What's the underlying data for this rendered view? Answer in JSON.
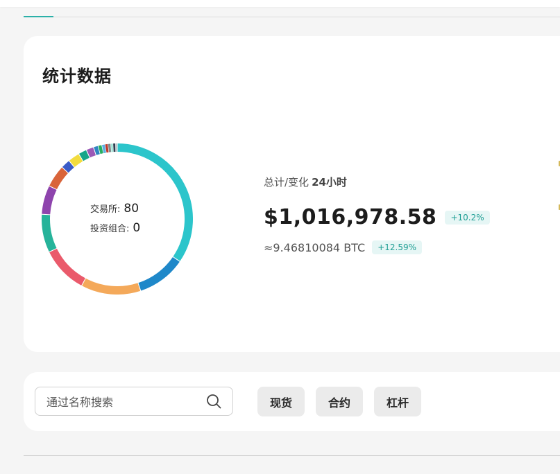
{
  "stats": {
    "title": "统计数据",
    "exchanges_label": "交易所:",
    "exchanges_count": "80",
    "portfolios_label": "投资组合:",
    "portfolios_count": "0",
    "summary_label": "总计/变化",
    "summary_period": "24小时",
    "total_value": "$1,016,978.58",
    "total_change": "+10.2%",
    "btc_value": "≈9.46810084 BTC",
    "btc_change": "+12.59%"
  },
  "donut": {
    "segments": [
      {
        "color": "#2cc5cb",
        "share": 0.345
      },
      {
        "color": "#1f88c9",
        "share": 0.105
      },
      {
        "color": "#f4a95a",
        "share": 0.128
      },
      {
        "color": "#ea5a6b",
        "share": 0.1
      },
      {
        "color": "#26b39a",
        "share": 0.082
      },
      {
        "color": "#8e44ad",
        "share": 0.062
      },
      {
        "color": "#d9643a",
        "share": 0.048
      },
      {
        "color": "#3a5bc7",
        "share": 0.02
      },
      {
        "color": "#f2dc3f",
        "share": 0.025
      },
      {
        "color": "#17a589",
        "share": 0.018
      },
      {
        "color": "#9b59b6",
        "share": 0.016
      },
      {
        "color": "#2e86c1",
        "share": 0.01
      },
      {
        "color": "#27ae60",
        "share": 0.008
      },
      {
        "color": "#5dade2",
        "share": 0.007
      },
      {
        "color": "#c0392b",
        "share": 0.006
      },
      {
        "color": "#7f8c8d",
        "share": 0.006
      },
      {
        "color": "#a3e4d7",
        "share": 0.005
      },
      {
        "color": "#2c3e50",
        "share": 0.005
      },
      {
        "color": "#bdc3c7",
        "share": 0.004
      }
    ]
  },
  "filters": {
    "search_placeholder": "通过名称搜索",
    "search_icon": "search-icon",
    "buttons": [
      "现货",
      "合约",
      "杠杆"
    ]
  },
  "colors": {
    "accent": "#2bb0a8",
    "badge_bg": "#e6f6f5",
    "badge_text": "#1e9e94"
  }
}
